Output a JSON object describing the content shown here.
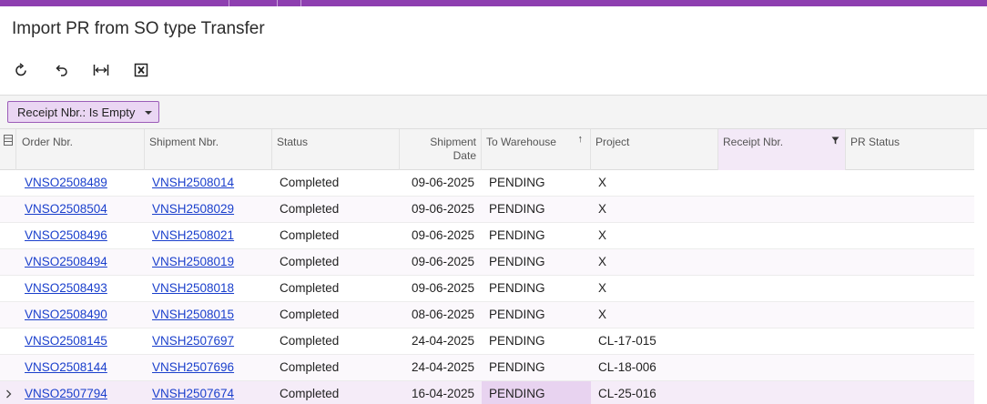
{
  "title": "Import PR from SO type Transfer",
  "toolbar": {
    "buttons": [
      {
        "name": "refresh-icon"
      },
      {
        "name": "undo-icon"
      },
      {
        "name": "fit-width-icon"
      },
      {
        "name": "excel-export-icon"
      }
    ]
  },
  "filter": {
    "label": "Receipt Nbr.: Is Empty"
  },
  "grid": {
    "columns": {
      "order_nbr": "Order Nbr.",
      "shipment_nbr": "Shipment Nbr.",
      "status": "Status",
      "shipment_date": "Shipment Date",
      "to_warehouse": "To Warehouse",
      "project": "Project",
      "receipt_nbr": "Receipt Nbr.",
      "pr_status": "PR Status"
    },
    "sort_indicator": "↑",
    "rows": [
      {
        "order_nbr": "VNSO2508489",
        "shipment_nbr": "VNSH2508014",
        "status": "Completed",
        "shipment_date": "09-06-2025",
        "to_warehouse": "PENDING",
        "project": "X",
        "receipt_nbr": "",
        "pr_status": ""
      },
      {
        "order_nbr": "VNSO2508504",
        "shipment_nbr": "VNSH2508029",
        "status": "Completed",
        "shipment_date": "09-06-2025",
        "to_warehouse": "PENDING",
        "project": "X",
        "receipt_nbr": "",
        "pr_status": ""
      },
      {
        "order_nbr": "VNSO2508496",
        "shipment_nbr": "VNSH2508021",
        "status": "Completed",
        "shipment_date": "09-06-2025",
        "to_warehouse": "PENDING",
        "project": "X",
        "receipt_nbr": "",
        "pr_status": ""
      },
      {
        "order_nbr": "VNSO2508494",
        "shipment_nbr": "VNSH2508019",
        "status": "Completed",
        "shipment_date": "09-06-2025",
        "to_warehouse": "PENDING",
        "project": "X",
        "receipt_nbr": "",
        "pr_status": ""
      },
      {
        "order_nbr": "VNSO2508493",
        "shipment_nbr": "VNSH2508018",
        "status": "Completed",
        "shipment_date": "09-06-2025",
        "to_warehouse": "PENDING",
        "project": "X",
        "receipt_nbr": "",
        "pr_status": ""
      },
      {
        "order_nbr": "VNSO2508490",
        "shipment_nbr": "VNSH2508015",
        "status": "Completed",
        "shipment_date": "08-06-2025",
        "to_warehouse": "PENDING",
        "project": "X",
        "receipt_nbr": "",
        "pr_status": ""
      },
      {
        "order_nbr": "VNSO2508145",
        "shipment_nbr": "VNSH2507697",
        "status": "Completed",
        "shipment_date": "24-04-2025",
        "to_warehouse": "PENDING",
        "project": "CL-17-015",
        "receipt_nbr": "",
        "pr_status": ""
      },
      {
        "order_nbr": "VNSO2508144",
        "shipment_nbr": "VNSH2507696",
        "status": "Completed",
        "shipment_date": "24-04-2025",
        "to_warehouse": "PENDING",
        "project": "CL-18-006",
        "receipt_nbr": "",
        "pr_status": ""
      },
      {
        "order_nbr": "VNSO2507794",
        "shipment_nbr": "VNSH2507674",
        "status": "Completed",
        "shipment_date": "16-04-2025",
        "to_warehouse": "PENDING",
        "project": "CL-25-016",
        "receipt_nbr": "",
        "pr_status": "",
        "selected": true
      }
    ]
  },
  "colors": {
    "accent": "#8e3fb0",
    "link": "#1a3fcc",
    "filter_chip_bg": "#ead6f3",
    "selected_row": "#f5ecf8"
  }
}
